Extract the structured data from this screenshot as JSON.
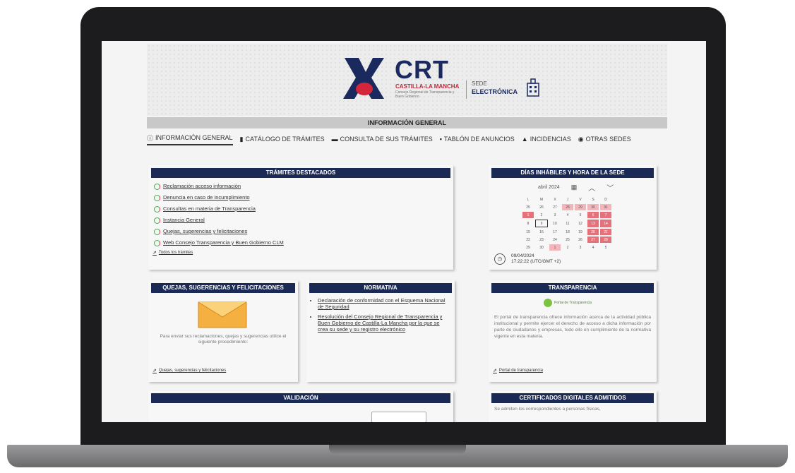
{
  "header": {
    "logo_text": "CRT",
    "logo_region": "CASTILLA-LA MANCHA",
    "logo_council": "Consejo Regional de Transparencia y Buen Gobierno",
    "sede_label": "SEDE",
    "electronica_label": "ELECTRÓNICA"
  },
  "topbar": {
    "title": "INFORMACIÓN GENERAL"
  },
  "nav": [
    {
      "label": "INFORMACIÓN GENERAL",
      "icon": "info-icon"
    },
    {
      "label": "CATÁLOGO DE TRÁMITES",
      "icon": "document-icon"
    },
    {
      "label": "CONSULTA DE SUS TRÁMITES",
      "icon": "folder-icon"
    },
    {
      "label": "TABLÓN DE ANUNCIOS",
      "icon": "board-icon"
    },
    {
      "label": "INCIDENCIAS",
      "icon": "warning-icon"
    },
    {
      "label": "OTRAS SEDES",
      "icon": "globe-icon"
    }
  ],
  "tramites": {
    "title": "TRÁMITES DESTACADOS",
    "items": [
      "Reclamación acceso información",
      "Denuncia en caso de incumplimiento",
      "Consultas en materia de Transparencia",
      "Instancia General",
      "Quejas, sugerencias y felicitaciones",
      "Web Consejo Transparencia y Buen Gobierno CLM"
    ],
    "all_link": "Todos los trámites"
  },
  "dias": {
    "title": "DÍAS INHÁBILES Y HORA DE LA SEDE",
    "month": "abril 2024",
    "weekdays": [
      "L",
      "M",
      "X",
      "J",
      "V",
      "S",
      "D"
    ],
    "weeks": [
      [
        "25",
        "26",
        "27",
        "28",
        "29",
        "30",
        "31"
      ],
      [
        "1",
        "2",
        "3",
        "4",
        "5",
        "6",
        "7"
      ],
      [
        "8",
        "9",
        "10",
        "11",
        "12",
        "13",
        "14"
      ],
      [
        "15",
        "16",
        "17",
        "18",
        "19",
        "20",
        "21"
      ],
      [
        "22",
        "23",
        "24",
        "25",
        "26",
        "27",
        "28"
      ],
      [
        "29",
        "30",
        "1",
        "2",
        "3",
        "4",
        "5"
      ]
    ],
    "date": "09/04/2024",
    "time": "17:22:22 (UTC/GMT +2)"
  },
  "quejas": {
    "title": "QUEJAS, SUGERENCIAS Y FELICITACIONES",
    "text": "Para enviar sus reclamaciones, quejas y sugerencias utilice el siguiente procedimiento:",
    "link": "Quejas, sugerencias y felicitaciones"
  },
  "normativa": {
    "title": "NORMATIVA",
    "items": [
      "Declaración de conformidad con el Esquema Nacional de Seguridad",
      "Resolución del Consejo Regional de Transparencia y Buen Gobierno de Castilla-La Mancha por la que se crea su sede y su registro electrónico"
    ]
  },
  "transparencia": {
    "title": "TRANSPARENCIA",
    "badge": "Portal de Transparencia",
    "text": "El portal de transparencia ofrece información acerca de la actividad pública institucional y permite ejercer el derecho de acceso a dicha información por parte de ciudadanos y empresas, todo ello en cumplimiento de la normativa vigente en esta materia.",
    "link": "Portal de transparencia"
  },
  "validacion": {
    "title": "VALIDACIÓN"
  },
  "certificados": {
    "title": "CERTIFICADOS DIGITALES ADMITIDOS",
    "text": "Se admiten los correspondientes a personas físicas,"
  },
  "colors": {
    "navy": "#1b2a55",
    "holiday": "#e5727a",
    "brand_red": "#c0283c"
  }
}
